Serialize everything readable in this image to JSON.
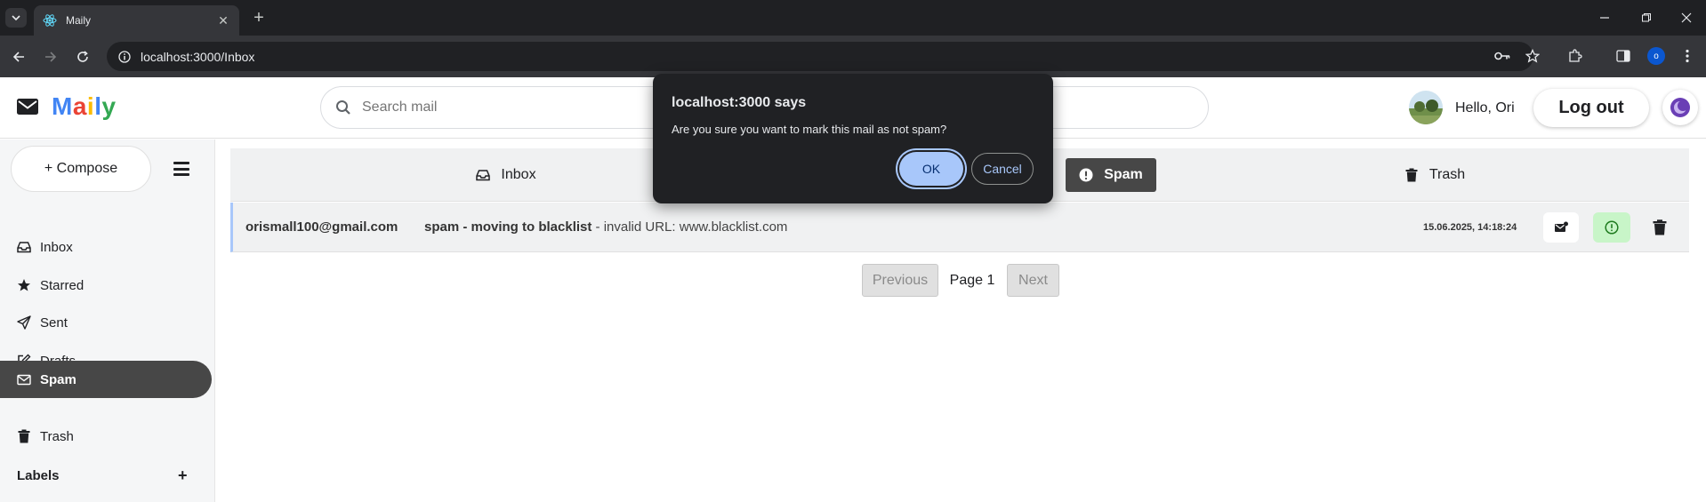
{
  "browser": {
    "tab_title": "Maily",
    "url": "localhost:3000/Inbox",
    "profile_initial": "o"
  },
  "app": {
    "brand": [
      "M",
      "a",
      "i",
      "l",
      "y"
    ],
    "brand_colors": [
      "#4285F4",
      "#EA4335",
      "#FBBC05",
      "#4285F4",
      "#34A853"
    ],
    "search_placeholder": "Search mail",
    "greeting": "Hello, Ori",
    "logout_label": "Log out"
  },
  "sidebar": {
    "compose_label": "+ Compose",
    "items": [
      {
        "label": "Inbox",
        "icon": "inbox-icon"
      },
      {
        "label": "Starred",
        "icon": "star-icon"
      },
      {
        "label": "Sent",
        "icon": "send-icon"
      },
      {
        "label": "Drafts",
        "icon": "edit-icon"
      },
      {
        "label": "Spam",
        "icon": "spam-envelope-icon",
        "active": true
      },
      {
        "label": "Trash",
        "icon": "trash-icon"
      }
    ],
    "labels_title": "Labels",
    "labels_add": "+"
  },
  "folder_tabs": [
    {
      "label": "Inbox",
      "icon": "inbox-icon"
    },
    {
      "label": "Spam",
      "icon": "exclamation-circle-icon",
      "active": true
    },
    {
      "label": "Trash",
      "icon": "trash-icon"
    }
  ],
  "mail_rows": [
    {
      "sender": "orismall100@gmail.com",
      "subject": "spam - moving to blacklist",
      "snippet": " - invalid URL: www.blacklist.com",
      "date": "15.06.2025, 14:18:24"
    }
  ],
  "pagination": {
    "previous_label": "Previous",
    "page_label": "Page 1",
    "next_label": "Next"
  },
  "dialog": {
    "title": "localhost:3000 says",
    "message": "Are you sure you want to mark this mail as not spam?",
    "ok_label": "OK",
    "cancel_label": "Cancel"
  },
  "colors": {
    "accent": "#a8c7fa",
    "active_nav": "#474747",
    "not_spam_action": "#c8f5c8"
  }
}
